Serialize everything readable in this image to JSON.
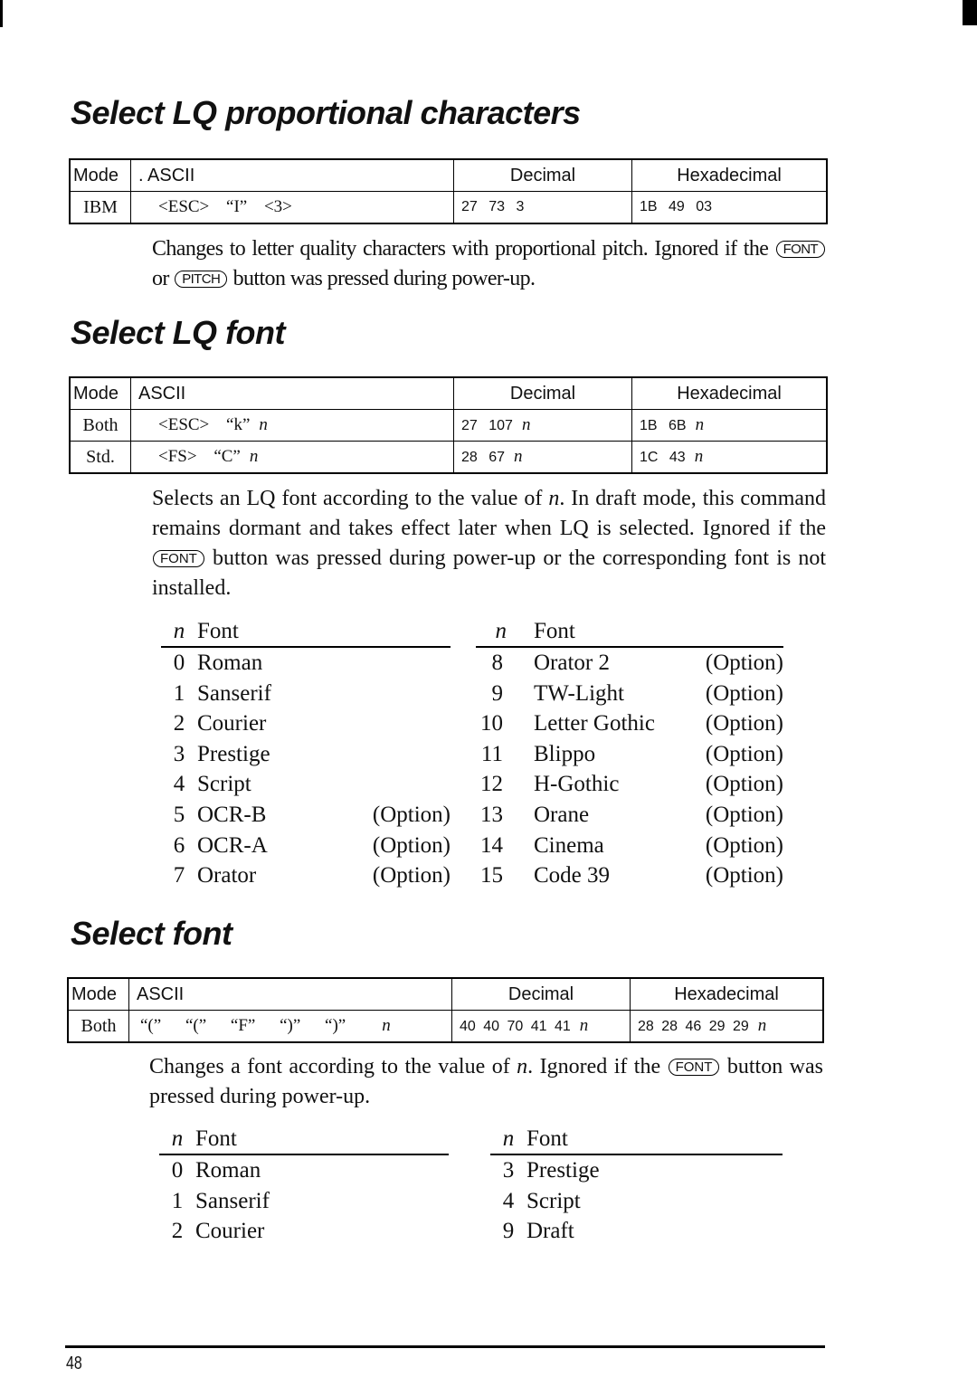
{
  "sections": [
    {
      "title": "Select LQ proportional characters",
      "table": {
        "headers": {
          "mode": "Mode",
          "ascii": ". ASCII",
          "decimal": "Decimal",
          "hex": "Hexadecimal"
        },
        "rows": [
          {
            "mode": "IBM",
            "ascii": "<ESC>  “I”  <3>",
            "decimal": "27  73  3",
            "hex": "1B  49  03",
            "n": ""
          }
        ]
      },
      "description": {
        "part1": "Changes to letter quality characters with proportional pitch. Ignored if the",
        "key1": "FONT",
        "part2": "or",
        "key2": "PITCH",
        "part3": "button was pressed during power-up."
      }
    },
    {
      "title": "Select LQ font",
      "table": {
        "headers": {
          "mode": "Mode",
          "ascii": "ASCII",
          "decimal": "Decimal",
          "hex": "Hexadecimal"
        },
        "rows": [
          {
            "mode": "Both",
            "ascii": "<ESC>  “k”",
            "decimal": "27 107",
            "hex": "1B  6B",
            "n": "n"
          },
          {
            "mode": "Std.",
            "ascii": "<FS>  “C”",
            "decimal": "28  67",
            "hex": "1C  43",
            "n": "n"
          }
        ]
      },
      "description": {
        "part1": "Selects an LQ font according to the value of",
        "n": "n",
        "part2": ". In draft mode, this command remains dormant and takes effect later when LQ is selected. Ignored if the",
        "key1": "FONT",
        "part3": "button was pressed during power-up or the corresponding font is not installed."
      },
      "font_list_header": {
        "n": "n",
        "font": "Font"
      },
      "fonts_left": [
        {
          "n": "0",
          "name": "Roman",
          "option": ""
        },
        {
          "n": "1",
          "name": "Sanserif",
          "option": ""
        },
        {
          "n": "2",
          "name": "Courier",
          "option": ""
        },
        {
          "n": "3",
          "name": "Prestige",
          "option": ""
        },
        {
          "n": "4",
          "name": "Script",
          "option": ""
        },
        {
          "n": "5",
          "name": "OCR-B",
          "option": "(Option)"
        },
        {
          "n": "6",
          "name": "OCR-A",
          "option": "(Option)"
        },
        {
          "n": "7",
          "name": "Orator",
          "option": "(Option)"
        }
      ],
      "fonts_right": [
        {
          "n": "8",
          "name": "Orator 2",
          "option": "(Option)"
        },
        {
          "n": "9",
          "name": "TW-Light",
          "option": "(Option)"
        },
        {
          "n": "10",
          "name": "Letter Gothic",
          "option": "(Option)"
        },
        {
          "n": "11",
          "name": "Blippo",
          "option": "(Option)"
        },
        {
          "n": "12",
          "name": "H-Gothic",
          "option": "(Option)"
        },
        {
          "n": "13",
          "name": "Orane",
          "option": "(Option)"
        },
        {
          "n": "14",
          "name": "Cinema",
          "option": "(Option)"
        },
        {
          "n": "15",
          "name": "Code 39",
          "option": "(Option)"
        }
      ]
    },
    {
      "title": "Select font",
      "table": {
        "headers": {
          "mode": "Mode",
          "ascii": "ASCII",
          "decimal": "Decimal",
          "hex": "Hexadecimal"
        },
        "rows": [
          {
            "mode": "Both",
            "ascii": "“(”  “(”  “F”  “)”  “)”",
            "decimal": "40 40 70 41 41",
            "hex": "28 28 46 29 29",
            "n": "n"
          }
        ]
      },
      "description": {
        "part1": "Changes a font according to the value of",
        "n": "n",
        "part2": ". Ignored if the",
        "key1": "FONT",
        "part3": "button was pressed during power-up."
      },
      "font_list_header": {
        "n": "n",
        "font": "Font"
      },
      "fonts_left": [
        {
          "n": "0",
          "name": "Roman"
        },
        {
          "n": "1",
          "name": "Sanserif"
        },
        {
          "n": "2",
          "name": "Courier"
        }
      ],
      "fonts_right": [
        {
          "n": "3",
          "name": "Prestige"
        },
        {
          "n": "4",
          "name": "Script"
        },
        {
          "n": "9",
          "name": "Draft"
        }
      ]
    }
  ],
  "footer": {
    "page_number": "48"
  }
}
